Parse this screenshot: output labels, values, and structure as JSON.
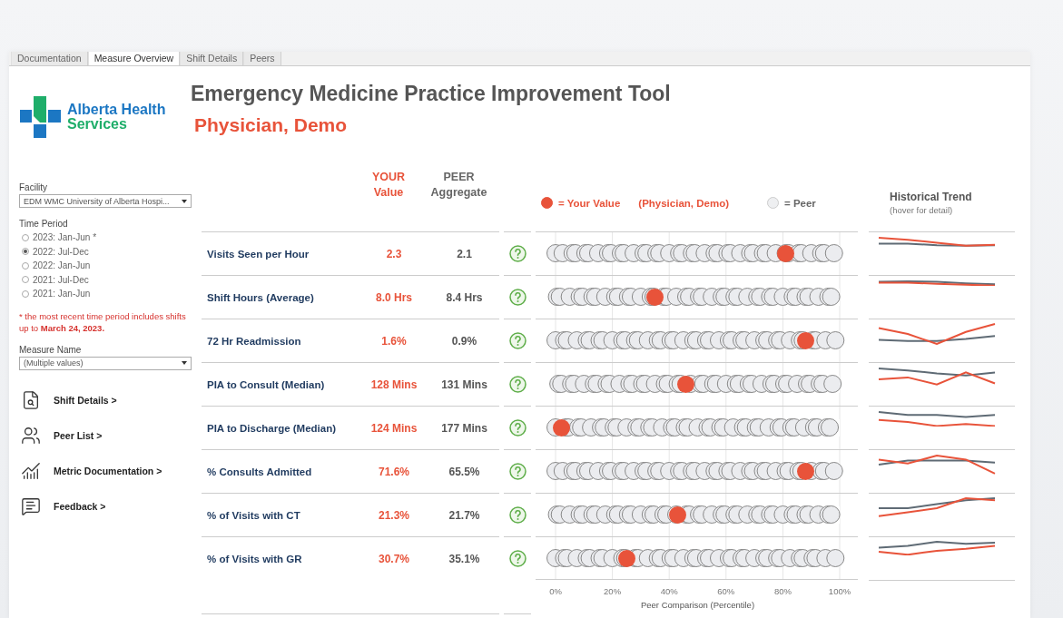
{
  "tabs": [
    {
      "label": "Documentation",
      "selected": false
    },
    {
      "label": "Measure Overview",
      "selected": true
    },
    {
      "label": "Shift Details",
      "selected": false
    },
    {
      "label": "Peers",
      "selected": false
    }
  ],
  "logo": {
    "line_1": "Alberta Health",
    "line_2": "Services"
  },
  "title": "Emergency Medicine Practice Improvement Tool",
  "physician": "Physician, Demo",
  "sidebar": {
    "facility": {
      "label": "Facility",
      "value": "EDM WMC University of Alberta Hospi..."
    },
    "time_period": {
      "label": "Time Period",
      "options": [
        {
          "label": "2023: Jan-Jun *",
          "selected": false
        },
        {
          "label": "2022: Jul-Dec",
          "selected": true
        },
        {
          "label": "2022: Jan-Jun",
          "selected": false
        },
        {
          "label": "2021: Jul-Dec",
          "selected": false
        },
        {
          "label": "2021: Jan-Jun",
          "selected": false
        }
      ]
    },
    "note": "* the most recent time period includes shifts up to **March 24, 2023.**",
    "measure": {
      "label": "Measure Name",
      "value": "(Multiple values)"
    },
    "links": [
      {
        "label": "Shift Details >",
        "kind": "document"
      },
      {
        "label": "Peer List >",
        "kind": "people"
      },
      {
        "label": "Metric Documentation >",
        "kind": "chart"
      },
      {
        "label": "Feedback >",
        "kind": "message"
      }
    ]
  },
  "headers": {
    "your": "YOUR\nValue",
    "peer": "PEER\nAggregate"
  },
  "legend": {
    "your": "= Your Value",
    "physician": "(Physician, Demo)",
    "peer": "= Peer"
  },
  "trend_header": {
    "title": "Historical Trend",
    "hint": "(hover for detail)"
  },
  "rows": [
    {
      "measure": "Visits Seen per Hour",
      "your_value": "2.3",
      "peer_value": "2.1",
      "level": 0.81
    },
    {
      "measure": "Shift Hours (Average)",
      "your_value": "8.0 Hrs",
      "peer_value": "8.4 Hrs",
      "level": 0.35
    },
    {
      "measure": "72 Hr Readmission",
      "your_value": "1.6%",
      "peer_value": "0.9%",
      "level": 0.88
    },
    {
      "measure": "PIA to Consult (Median)",
      "your_value": "128 Mins",
      "peer_value": "131 Mins",
      "level": 0.46
    },
    {
      "measure": "PIA to Discharge (Median)",
      "your_value": "124 Mins",
      "peer_value": "177 Mins",
      "level": 0.02
    },
    {
      "measure": "% Consults Admitted",
      "your_value": "71.6%",
      "peer_value": "65.5%",
      "level": 0.88
    },
    {
      "measure": "% of Visits with CT",
      "your_value": "21.3%",
      "peer_value": "21.7%",
      "level": 0.43
    },
    {
      "measure": "% of Visits with GR",
      "your_value": "30.7%",
      "peer_value": "35.1%",
      "level": 0.25
    }
  ],
  "axis": {
    "ticks": [
      "0%",
      "20%",
      "40%",
      "60%",
      "80%",
      "100%"
    ],
    "title": "Peer Comparison (Percentile)"
  }
}
